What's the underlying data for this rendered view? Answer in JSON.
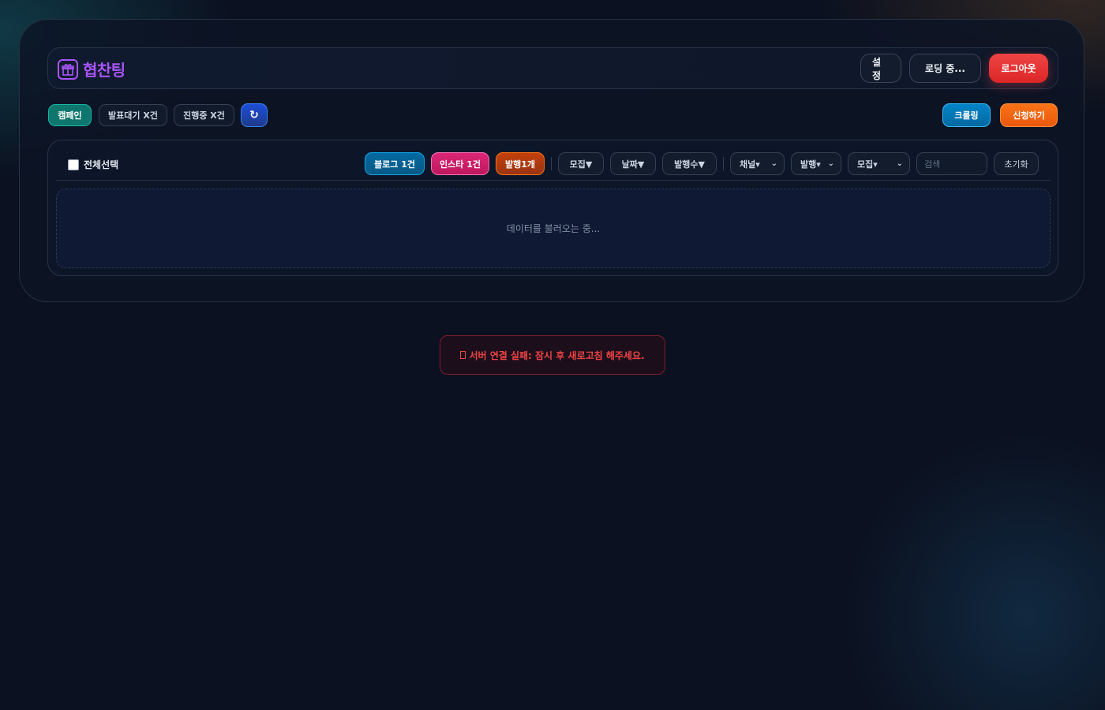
{
  "app": {
    "logo_text": "협찬팅"
  },
  "header": {
    "settings_label": "설정",
    "user_label": "로딩 중...",
    "logout_label": "로그아웃"
  },
  "status_bar": {
    "campaign_label": "캠페인",
    "pending_label": "발표대기 X건",
    "in_progress_label": "진행중 X건",
    "refresh_icon": "↻",
    "crawl_label": "크롤링",
    "apply_label": "신청하기"
  },
  "toolbar": {
    "select_all_label": "전체선택",
    "blog_filter": "블로그 1건",
    "insta_filter": "인스타 1건",
    "publish_filter": "발행1개",
    "sort_recruit": "모집▼",
    "sort_date": "날짜▼",
    "sort_publish_count": "발행수▼",
    "channel_select": "채널▾",
    "publish_select": "발행▾",
    "recruit_select": "모집▾",
    "search_placeholder": "검색",
    "reset_label": "초기화"
  },
  "content": {
    "loading_text": "데이터를 불러오는 중..."
  },
  "toast": {
    "message": "서버 연결 실패: 잠시 후 새로고침 해주세요."
  },
  "colors": {
    "brand": "#a855f7",
    "logout": "#ef4444",
    "teal": "#0f766e",
    "blog": "#0369a1",
    "insta": "#db2777",
    "publish": "#c2410c",
    "apply": "#f97316",
    "error": "#ef4444"
  },
  "icons": {
    "logo": "gift-icon",
    "refresh": "refresh-icon",
    "dropdown": "chevron-down-icon",
    "toast": "missing-glyph-icon"
  }
}
